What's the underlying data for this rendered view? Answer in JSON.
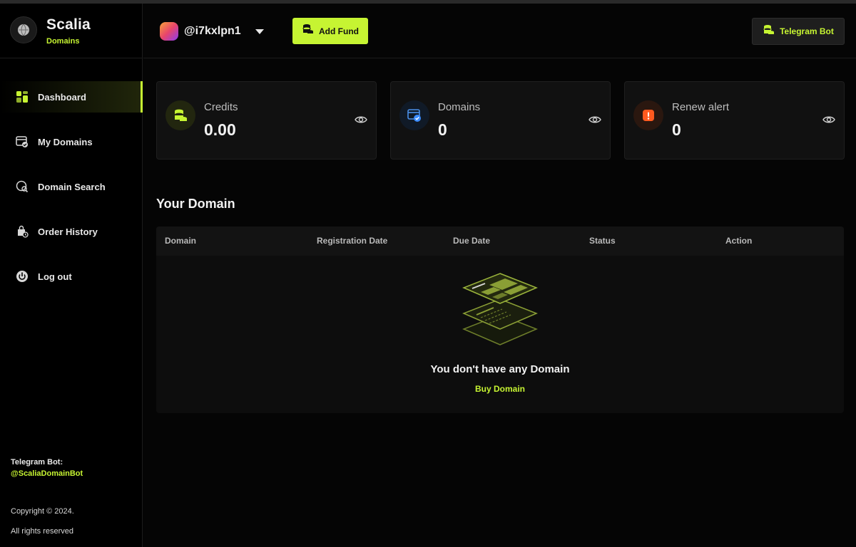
{
  "brand": {
    "name": "Scalia",
    "subtitle": "Domains",
    "logo_icon": "globe-icon"
  },
  "sidebar": {
    "items": [
      {
        "label": "Dashboard",
        "icon": "dashboard-grid-icon",
        "active": true
      },
      {
        "label": "My Domains",
        "icon": "browser-check-icon",
        "active": false
      },
      {
        "label": "Domain Search",
        "icon": "search-domain-icon",
        "active": false
      },
      {
        "label": "Order History",
        "icon": "bag-clock-icon",
        "active": false
      },
      {
        "label": "Log out",
        "icon": "power-icon",
        "active": false
      }
    ],
    "footer": {
      "telegram_title": "Telegram Bot:",
      "telegram_handle": "@ScaliaDomainBot",
      "copyright": "Copyright © 2024.",
      "rights": "All rights reserved"
    }
  },
  "header": {
    "username": "@i7kxlpn1",
    "add_fund_label": "Add Fund",
    "telegram_bot_label": "Telegram Bot"
  },
  "cards": [
    {
      "label": "Credits",
      "value": "0.00",
      "icon": "coins-icon"
    },
    {
      "label": "Domains",
      "value": "0",
      "icon": "browser-check-icon"
    },
    {
      "label": "Renew alert",
      "value": "0",
      "icon": "alert-icon"
    }
  ],
  "domains_section": {
    "title": "Your Domain",
    "columns": [
      "Domain",
      "Registration Date",
      "Due Date",
      "Status",
      "Action"
    ],
    "empty_message": "You don't have any Domain",
    "buy_link": "Buy Domain"
  },
  "colors": {
    "accent": "#c6f432",
    "background": "#050505",
    "card": "#111111",
    "alert": "#ff5a1f",
    "info": "#3b8cff"
  }
}
